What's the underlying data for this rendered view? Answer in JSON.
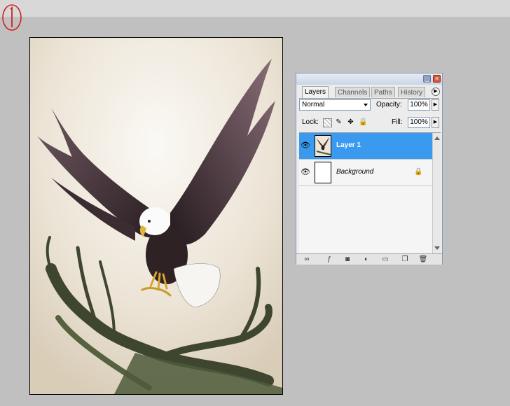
{
  "annotation": {
    "step_mark": "1"
  },
  "palette": {
    "title_buttons": {
      "minimize": "_",
      "close": "×"
    },
    "tabs": [
      {
        "label": "Layers",
        "active": true
      },
      {
        "label": "Channels",
        "active": false
      },
      {
        "label": "Paths",
        "active": false
      },
      {
        "label": "History",
        "active": false
      }
    ],
    "blend_mode": "Normal",
    "opacity_label": "Opacity:",
    "opacity_value": "100%",
    "lock_label": "Lock:",
    "fill_label": "Fill:",
    "fill_value": "100%",
    "layers": [
      {
        "name": "Layer 1",
        "visible": true,
        "selected": true,
        "thumbnail": "eagle-thumbnail"
      },
      {
        "name": "Background",
        "visible": true,
        "selected": false,
        "locked": true,
        "thumbnail": "blank-white-thumbnail"
      }
    ],
    "bottom_icons": [
      "link-icon",
      "layer-style-icon",
      "mask-icon",
      "adjustment-layer-icon",
      "new-group-icon",
      "new-layer-icon",
      "trash-icon"
    ]
  },
  "colors": {
    "selection": "#3a9af0",
    "workspace": "#c0c0c0"
  }
}
